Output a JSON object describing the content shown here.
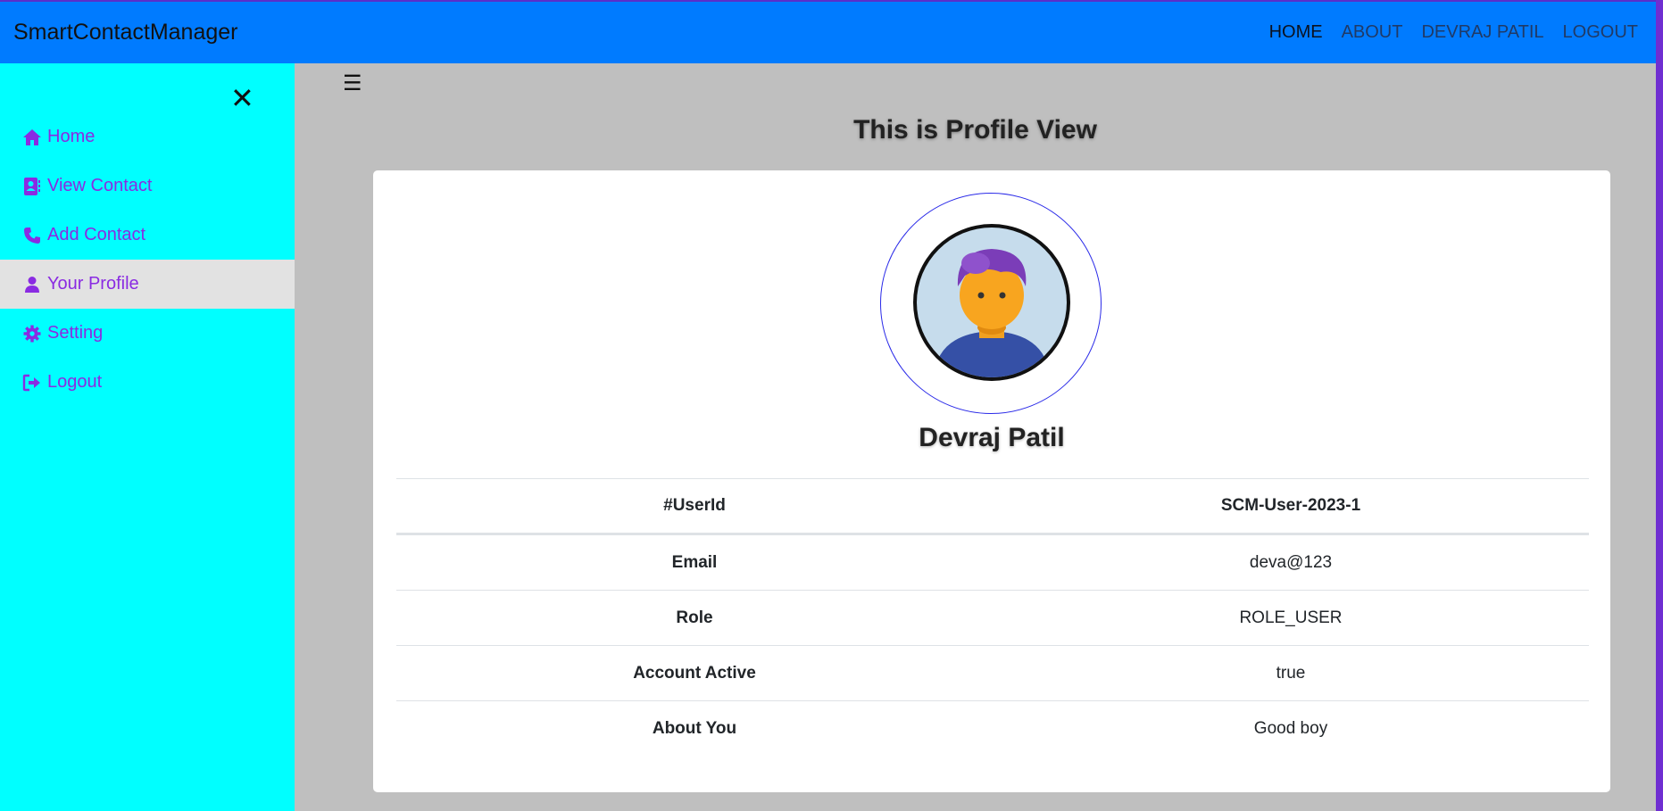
{
  "navbar": {
    "brand": "SmartContactManager",
    "links": [
      "HOME",
      "ABOUT",
      "DEVRAJ PATIL",
      "LOGOUT"
    ]
  },
  "sidebar": {
    "close_icon": "close-icon",
    "items": [
      {
        "label": "Home",
        "icon": "home-icon"
      },
      {
        "label": "View Contact",
        "icon": "contact-book-icon"
      },
      {
        "label": "Add Contact",
        "icon": "phone-icon"
      },
      {
        "label": "Your Profile",
        "icon": "user-icon"
      },
      {
        "label": "Setting",
        "icon": "gear-icon"
      },
      {
        "label": "Logout",
        "icon": "logout-icon"
      }
    ]
  },
  "main": {
    "menu_icon": "hamburger-icon",
    "title": "This is Profile View",
    "profile": {
      "name": "Devraj Patil",
      "avatar": "avatar-icon",
      "fields": [
        {
          "key": "#UserId",
          "value": "SCM-User-2023-1"
        },
        {
          "key": "Email",
          "value": "deva@123"
        },
        {
          "key": "Role",
          "value": "ROLE_USER"
        },
        {
          "key": "Account Active",
          "value": "true"
        },
        {
          "key": "About You",
          "value": "Good boy"
        }
      ]
    }
  },
  "colors": {
    "navbar": "#007bff",
    "sidebar": "#00ffff",
    "sidebar_text": "#8a2be2",
    "active_item": "#e2e2e2",
    "main_bg": "#bfbfbf"
  }
}
